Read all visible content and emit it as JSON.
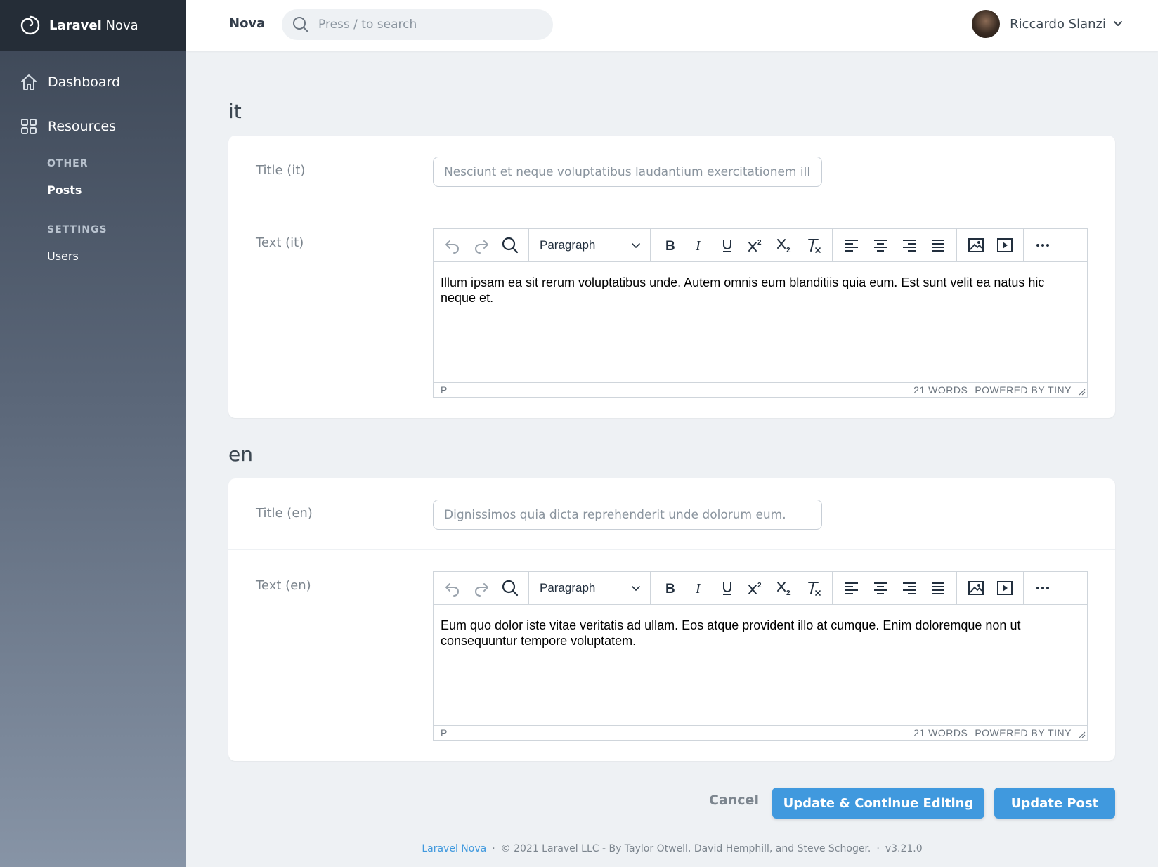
{
  "brand": {
    "name_bold": "Laravel",
    "name_rest": "Nova"
  },
  "sidebar": {
    "dashboard": "Dashboard",
    "resources": "Resources",
    "group_other": "OTHER",
    "posts": "Posts",
    "group_settings": "SETTINGS",
    "users": "Users"
  },
  "topbar": {
    "title": "Nova",
    "search_placeholder": "Press / to search",
    "user_name": "Riccardo Slanzi"
  },
  "sections": [
    {
      "heading": "it",
      "title_label": "Title (it)",
      "title_value": "Nesciunt et neque voluptatibus laudantium exercitationem illum.",
      "text_label": "Text (it)",
      "format": "Paragraph",
      "content": "Illum ipsam ea sit rerum voluptatibus unde. Autem omnis eum blanditiis quia eum. Est sunt velit ea natus hic neque et.",
      "status_path": "P",
      "word_count": "21 WORDS",
      "powered": "POWERED BY TINY"
    },
    {
      "heading": "en",
      "title_label": "Title (en)",
      "title_value": "Dignissimos quia dicta reprehenderit unde dolorum eum.",
      "text_label": "Text (en)",
      "format": "Paragraph",
      "content": "Eum quo dolor iste vitae veritatis ad ullam. Eos atque provident illo at cumque. Enim doloremque non ut consequuntur tempore voluptatem.",
      "status_path": "P",
      "word_count": "21 WORDS",
      "powered": "POWERED BY TINY"
    }
  ],
  "actions": {
    "cancel": "Cancel",
    "update_continue": "Update & Continue Editing",
    "update": "Update Post"
  },
  "footer": {
    "link": "Laravel Nova",
    "copyright": "© 2021 Laravel LLC - By Taylor Otwell, David Hemphill, and Steve Schoger.",
    "version": "v3.21.0"
  },
  "colors": {
    "primary": "#4099de",
    "sidebar_dark": "#252d37",
    "background": "#eef1f4"
  }
}
